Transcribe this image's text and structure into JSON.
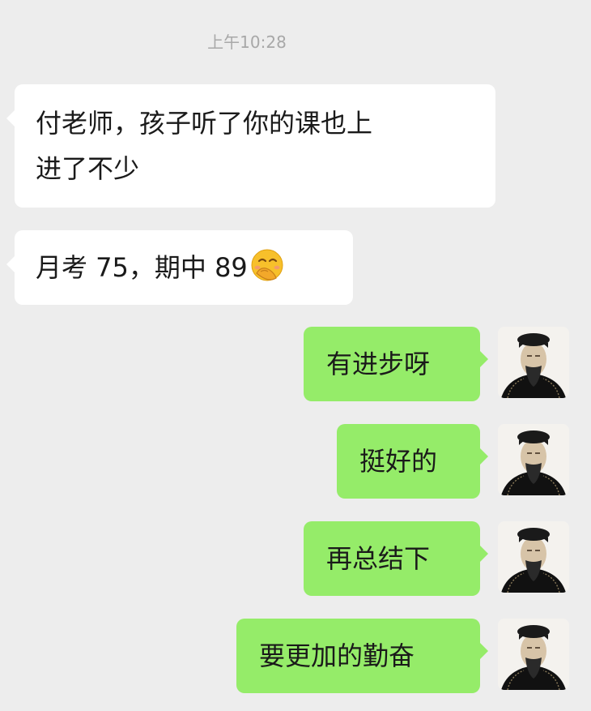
{
  "timestamp": "上午10:28",
  "messages": [
    {
      "direction": "in",
      "line1": "付老师，孩子听了你的课也上",
      "line2": "进了不少"
    },
    {
      "direction": "in",
      "text": "月考 75，期中 89",
      "emoji": "face-with-hand-over-mouth-emoji"
    },
    {
      "direction": "out",
      "text": "有进步呀"
    },
    {
      "direction": "out",
      "text": "挺好的"
    },
    {
      "direction": "out",
      "text": "再总结下"
    },
    {
      "direction": "out",
      "text": "要更加的勤奋"
    }
  ],
  "colors": {
    "background": "#ededed",
    "incoming_bubble": "#ffffff",
    "outgoing_bubble": "#95ec69",
    "timestamp_text": "#a8a8a8"
  }
}
